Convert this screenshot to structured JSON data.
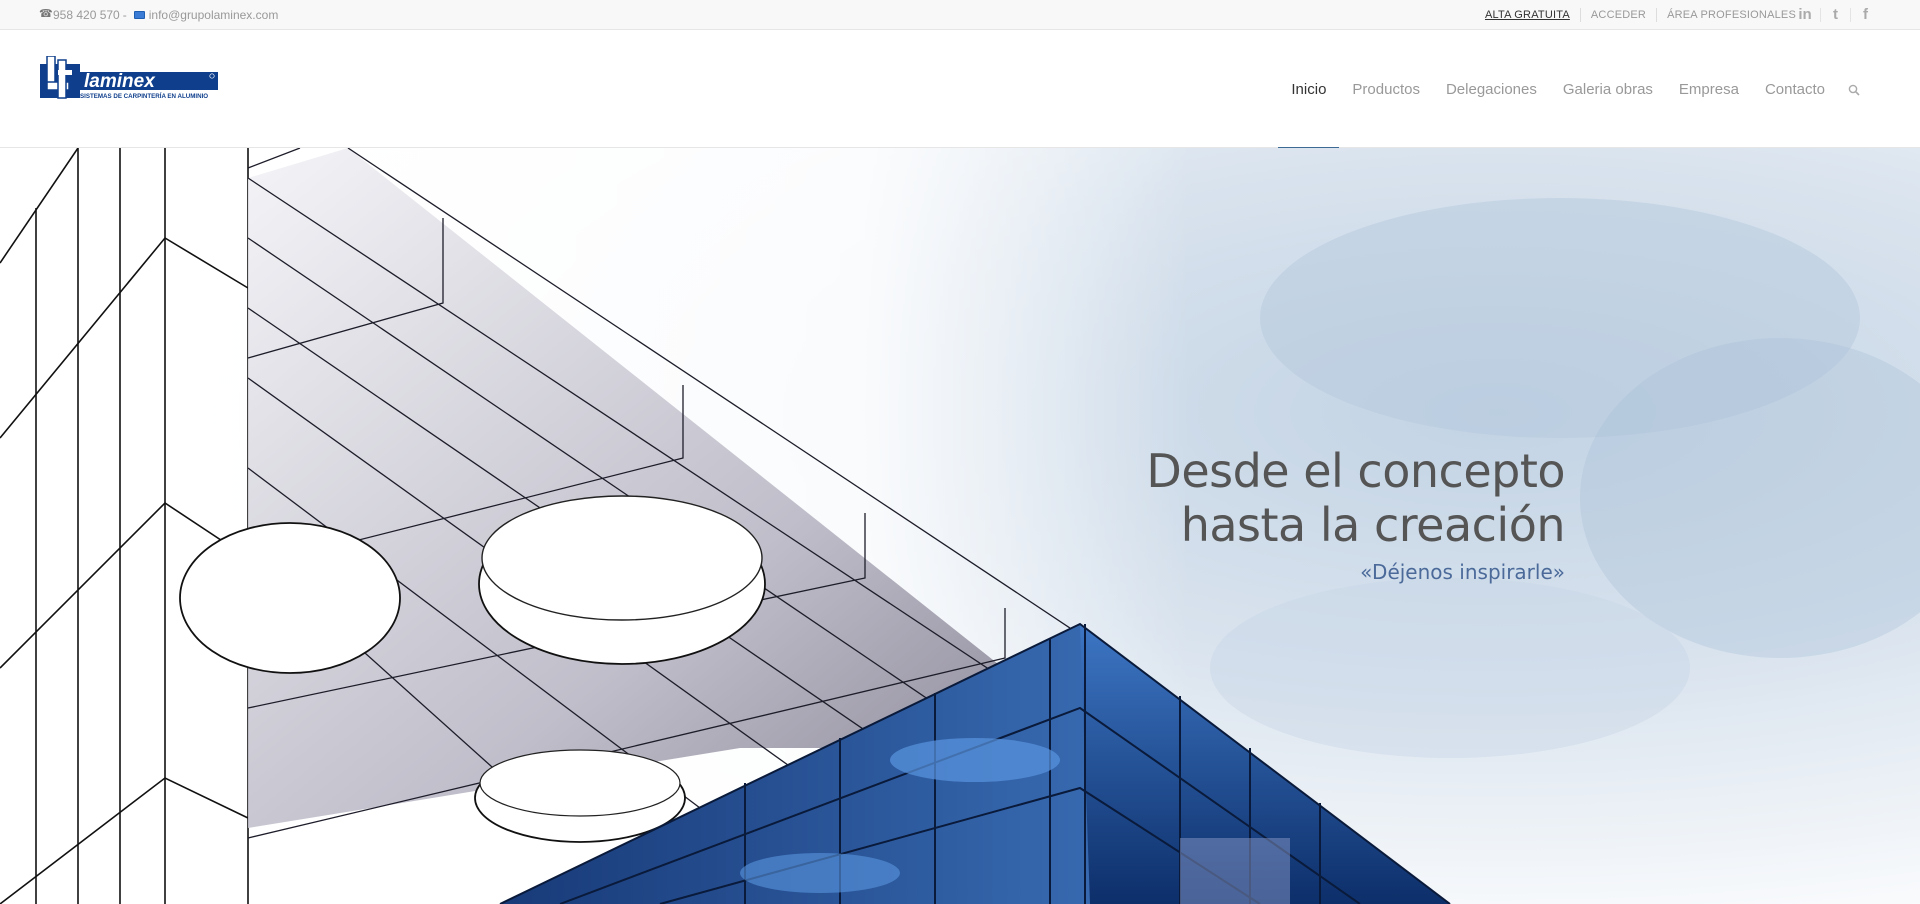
{
  "topbar": {
    "phone": "958 420 570",
    "separator": "-",
    "email": "info@grupolaminex.com",
    "links": [
      "ALTA GRATUITA",
      "ACCEDER",
      "ÁREA PROFESIONALES"
    ],
    "social_icons": [
      "linkedin-icon",
      "twitter-icon",
      "facebook-icon"
    ],
    "social_glyphs": [
      "in",
      "t",
      "f"
    ]
  },
  "logo": {
    "brand": "laminex",
    "tagline": "SISTEMAS DE CARPINTERÍA EN ALUMINIO"
  },
  "nav": {
    "items": [
      "Inicio",
      "Productos",
      "Delegaciones",
      "Galeria obras",
      "Empresa",
      "Contacto"
    ],
    "active": "Inicio",
    "search_icon": "search-icon"
  },
  "hero": {
    "title_line1": "Desde el concepto",
    "title_line2": "hasta la creación",
    "subtitle": "«Déjenos inspirarle»"
  },
  "colors": {
    "brand_blue": "#0f3f8c",
    "nav_active_underline": "#3d6a94",
    "subtitle": "#4b6a9a",
    "glass_blue": "#2d5fa8"
  }
}
